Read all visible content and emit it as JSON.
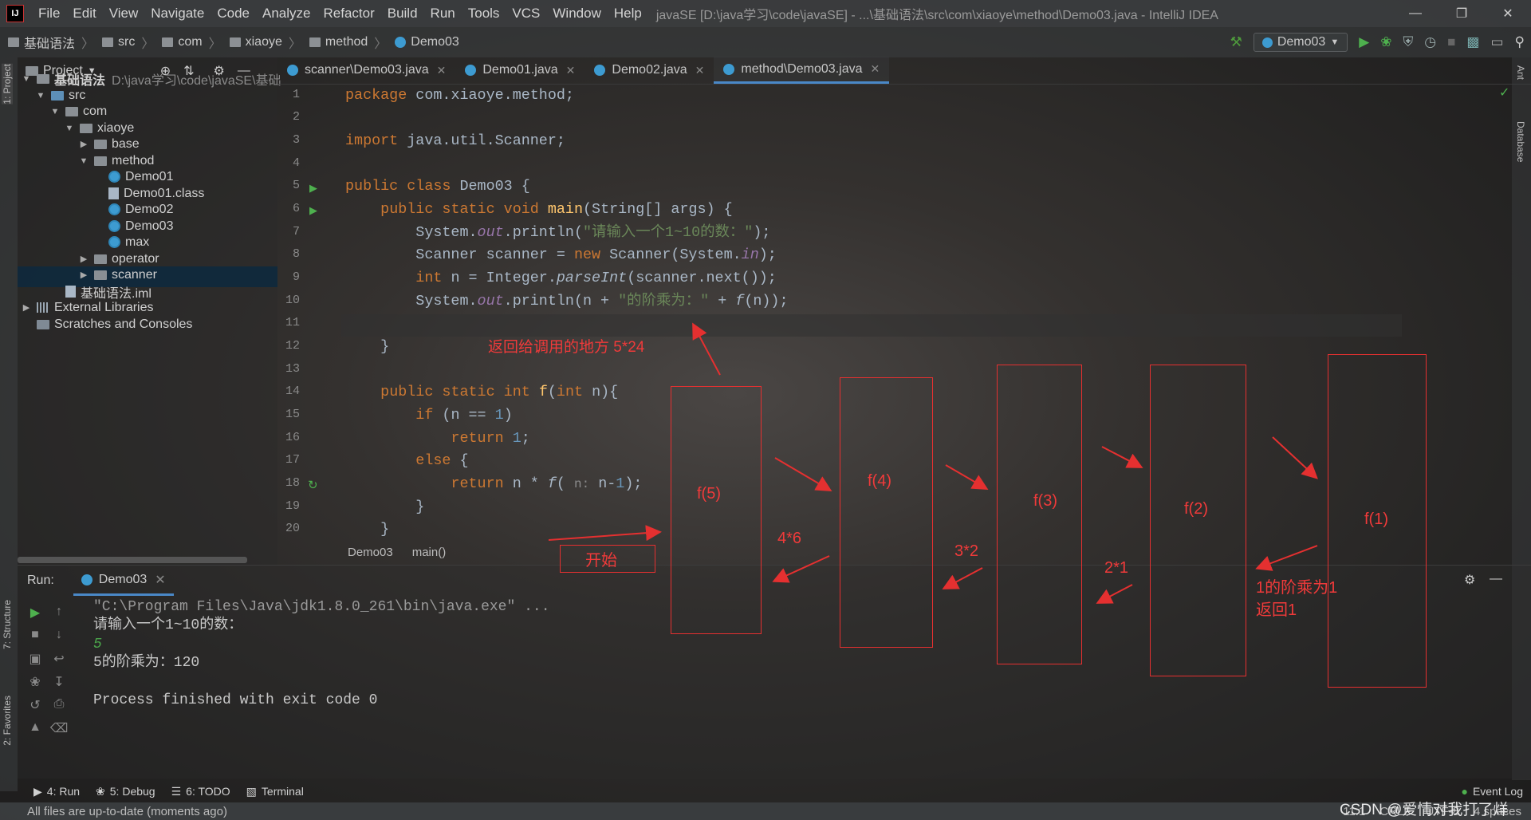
{
  "menu": {
    "items": [
      "File",
      "Edit",
      "View",
      "Navigate",
      "Code",
      "Analyze",
      "Refactor",
      "Build",
      "Run",
      "Tools",
      "VCS",
      "Window",
      "Help"
    ],
    "title": "javaSE [D:\\java学习\\code\\javaSE] - ...\\基础语法\\src\\com\\xiaoye\\method\\Demo03.java - IntelliJ IDEA"
  },
  "nav": {
    "crumbs": [
      "基础语法",
      "src",
      "com",
      "xiaoye",
      "method",
      "Demo03"
    ],
    "run_config": "Demo03"
  },
  "project": {
    "header": "Project",
    "tree": [
      {
        "label": "基础语法",
        "extra": "D:\\java学习\\code\\javaSE\\基础"
      },
      {
        "label": "src"
      },
      {
        "label": "com"
      },
      {
        "label": "xiaoye"
      },
      {
        "label": "base"
      },
      {
        "label": "method"
      },
      {
        "label": "Demo01"
      },
      {
        "label": "Demo01.class"
      },
      {
        "label": "Demo02"
      },
      {
        "label": "Demo03"
      },
      {
        "label": "max"
      },
      {
        "label": "operator"
      },
      {
        "label": "scanner"
      },
      {
        "label": "基础语法.iml"
      },
      {
        "label": "External Libraries"
      },
      {
        "label": "Scratches and Consoles"
      }
    ]
  },
  "tabs": [
    "scanner\\Demo03.java",
    "Demo01.java",
    "Demo02.java",
    "method\\Demo03.java"
  ],
  "editor": {
    "line_numbers": [
      "1",
      "2",
      "3",
      "4",
      "5",
      "6",
      "7",
      "8",
      "9",
      "10",
      "11",
      "12",
      "13",
      "14",
      "15",
      "16",
      "17",
      "18",
      "19",
      "20"
    ],
    "breadcrumb": [
      "Demo03",
      "main()"
    ]
  },
  "run": {
    "label": "Run:",
    "tab": "Demo03",
    "console": [
      "\"C:\\Program Files\\Java\\jdk1.8.0_261\\bin\\java.exe\" ...",
      "请输入一个1~10的数：",
      "5",
      "5的阶乘为：120",
      "",
      "Process finished with exit code 0"
    ]
  },
  "bottom_tools": [
    "4: Run",
    "5: Debug",
    "6: TODO",
    "Terminal"
  ],
  "side_tabs": {
    "left": [
      "1: Project",
      "7: Structure",
      "2: Favorites"
    ],
    "right": [
      "Ant",
      "Database"
    ]
  },
  "status": {
    "message": "All files are up-to-date (moments ago)",
    "position": "11:1",
    "line_sep": "CRLF",
    "encoding": "UTF-8",
    "indent": "4 spaces",
    "event_log": "Event Log"
  },
  "annotations": {
    "f5": "f(5)",
    "f4": "f(4)",
    "f3": "f(3)",
    "f2": "f(2)",
    "f1": "f(1)",
    "return_to_caller": "返回给调用的地方  5*24",
    "start": "开始",
    "r46": "4*6",
    "r32": "3*2",
    "r21": "2*1",
    "base1": "1的阶乘为1",
    "base2": "返回1"
  },
  "watermark": "CSDN @爱情对我打了烊",
  "colors": {
    "keyword": "#cc7832",
    "string": "#6a8759",
    "number": "#6897bb",
    "field": "#9876aa",
    "annotation": "#e53030",
    "accent": "#4a88c7"
  }
}
